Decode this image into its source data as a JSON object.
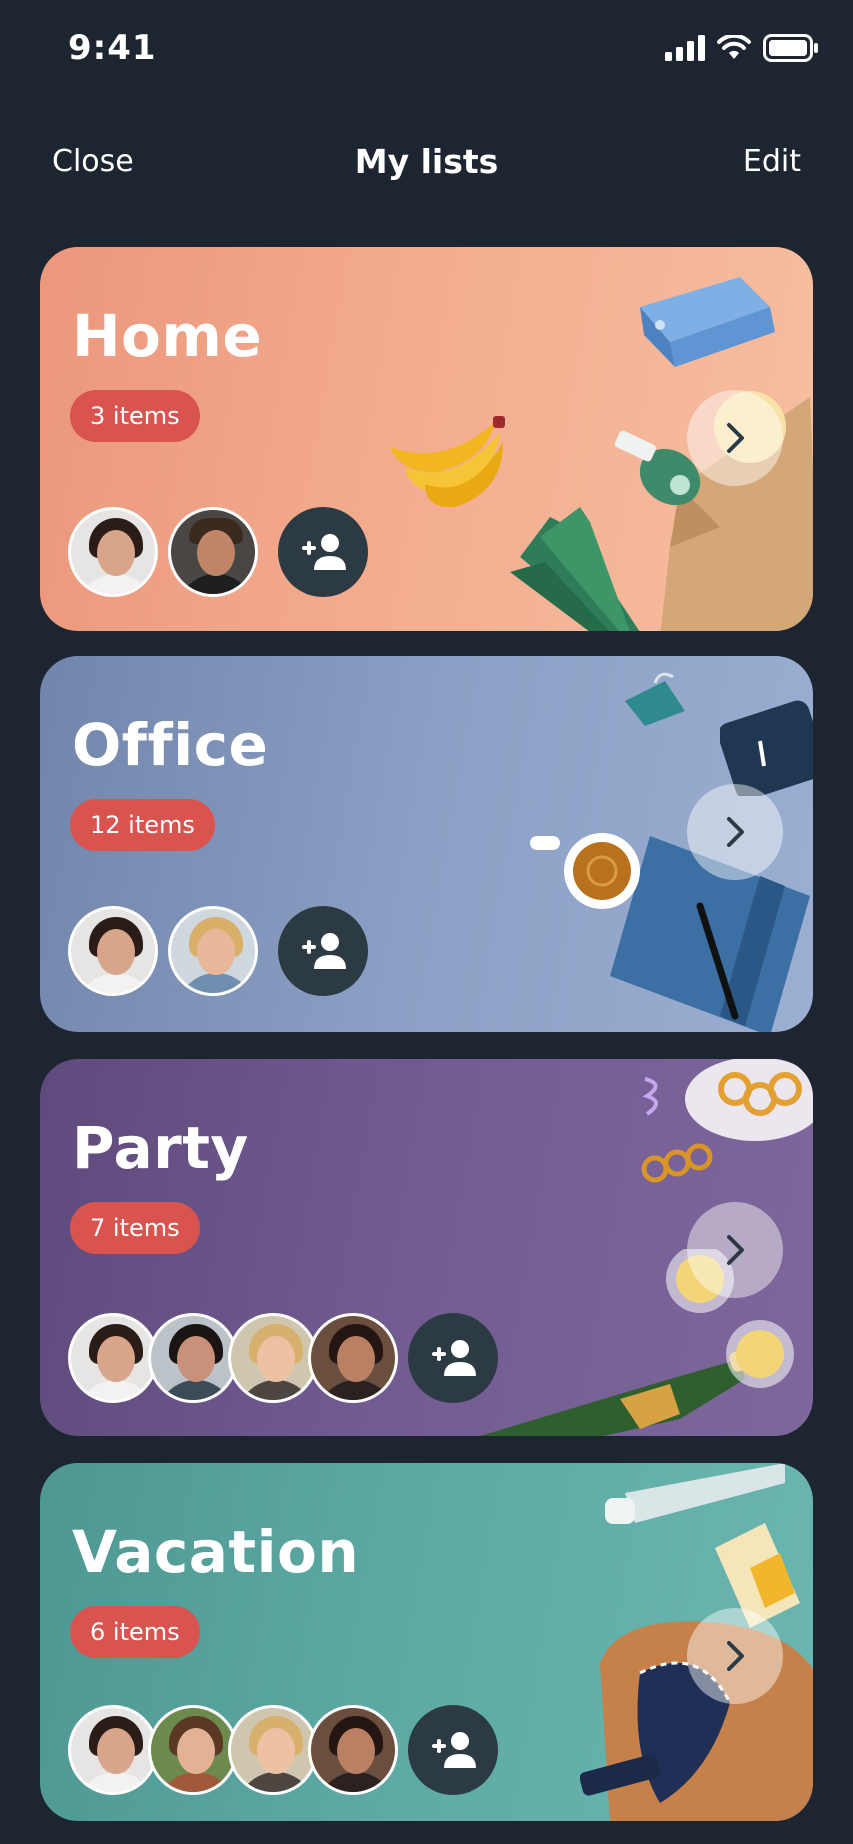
{
  "status_bar": {
    "time": "9:41"
  },
  "nav": {
    "close_label": "Close",
    "title": "My lists",
    "edit_label": "Edit"
  },
  "lists": [
    {
      "title": "Home",
      "count_label": "3 items",
      "color": "#f3ab8e"
    },
    {
      "title": "Office",
      "count_label": "12 items",
      "color": "#8c9fc4"
    },
    {
      "title": "Party",
      "count_label": "7 items",
      "color": "#735c92"
    },
    {
      "title": "Vacation",
      "count_label": "6 items",
      "color": "#5eaaa4"
    }
  ],
  "colors": {
    "background": "#1c2530",
    "badge": "#d9534f",
    "add_button": "#2c3a44"
  },
  "icons": {
    "add_member": "add-person-icon",
    "open": "chevron-right-icon"
  }
}
